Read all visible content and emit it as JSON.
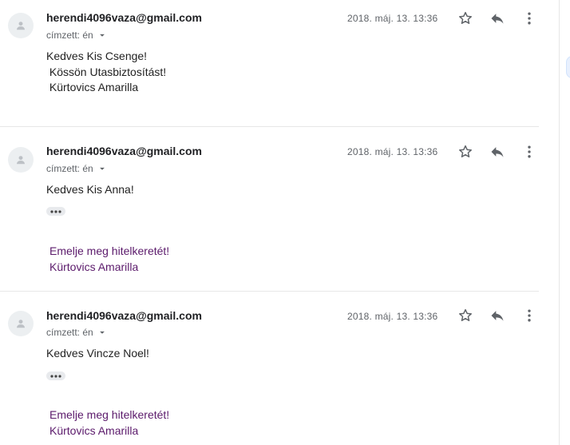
{
  "messages": [
    {
      "sender": "herendi4096vaza@gmail.com",
      "recipient": "címzett: én",
      "date": "2018. máj. 13. 13:36",
      "body": [
        "Kedves Kis Csenge!",
        " Kössön Utasbiztosítást!",
        " Kürtovics Amarilla"
      ]
    },
    {
      "sender": "herendi4096vaza@gmail.com",
      "recipient": "címzett: én",
      "date": "2018. máj. 13. 13:36",
      "greeting": "Kedves Kis Anna!",
      "links": [
        "Emelje meg hitelkeretét!",
        "Kürtovics Amarilla"
      ]
    },
    {
      "sender": "herendi4096vaza@gmail.com",
      "recipient": "címzett: én",
      "date": "2018. máj. 13. 13:36",
      "greeting": "Kedves Vincze Noel!",
      "links": [
        "Emelje meg hitelkeretét!",
        "Kürtovics Amarilla"
      ]
    }
  ],
  "icons": {
    "avatar": "person-icon",
    "dropdown": "caret-down-icon",
    "star": "star-icon",
    "reply": "reply-icon",
    "more": "more-vert-icon",
    "ellipsis": "show-trimmed-content-icon"
  },
  "colors": {
    "sender": "#202124",
    "meta": "#5f6368",
    "visited_link": "#5b1a6b",
    "icon": "#5f6368"
  }
}
